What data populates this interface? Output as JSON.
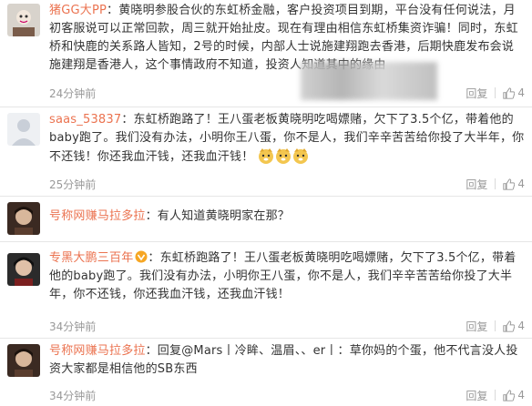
{
  "comments": [
    {
      "user": "猪GG大PP",
      "text": "：黄晓明参股合伙的东虹桥金融，客户投资项目到期，平台没有任何说法，月初客服说可以正常回款，周三就开始扯皮。现在有理由相信东虹桥集资诈骗！同时，东虹桥和快鹿的关系路人皆知，2号的时候，内部人士说施建翔跑去香港，后期快鹿发布会说施建翔是香港人，这个事情政府不知道，投资人知道其中的缘由",
      "time": "24分钟前",
      "reply": "回复",
      "likes": "4"
    },
    {
      "user": "saas_53837",
      "text": "：东虹桥跑路了！王八蛋老板黄晓明吃喝嫖赌，欠下了3.5个亿，带着他的baby跑了。我们没有办法，小明你王八蛋，你不是人，我们辛辛苦苦给你投了大半年，你不还钱！你还我血汗钱，还我血汗钱！",
      "time": "25分钟前",
      "reply": "回复",
      "likes": "4"
    },
    {
      "user": "号称网赚马拉多拉",
      "text": "：有人知道黄晓明家在那？",
      "time": "",
      "reply": "",
      "likes": ""
    },
    {
      "user": "专黑大鹏三百年",
      "text": "：东虹桥跑路了！王八蛋老板黄晓明吃喝嫖赌，欠下了3.5个亿，带着他的baby跑了。我们没有办法，小明你王八蛋，你不是人，我们辛辛苦苦给你投了大半年，你不还钱，你还我血汗钱，还我血汗钱！",
      "time": "34分钟前",
      "reply": "回复",
      "likes": "4"
    },
    {
      "user": "号称网赚马拉多拉",
      "text": "：回复@Mars丨冷眸、温眉、、er丨：草你妈的个蛋，他不代言没人投资大家都是相信他的SB东西",
      "time": "34分钟前",
      "reply": "回复",
      "likes": "4"
    }
  ],
  "colors": {
    "username": "#eb7350",
    "text": "#333333",
    "meta": "#999999"
  },
  "icons": {
    "like": "thumbs-up-icon",
    "emoji": "doge-emoji-icon",
    "vip": "vip-badge-icon"
  }
}
